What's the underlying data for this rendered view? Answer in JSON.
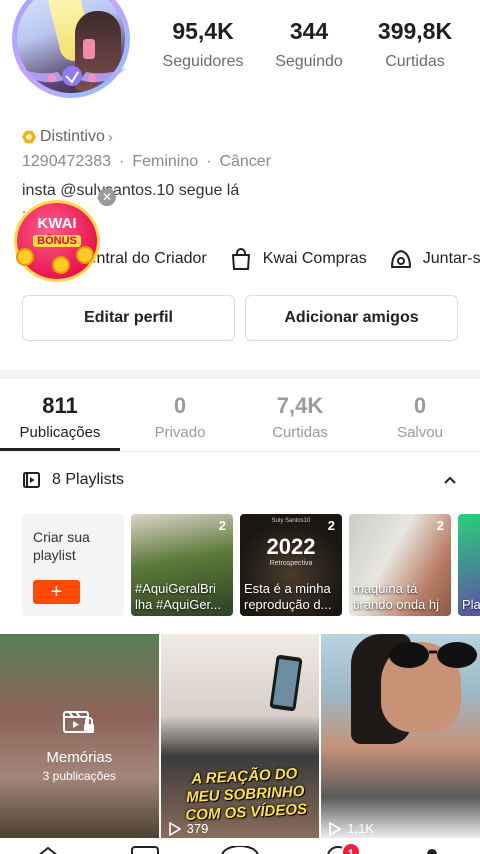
{
  "profile": {
    "stats": [
      {
        "value": "95,4K",
        "label": "Seguidores"
      },
      {
        "value": "344",
        "label": "Seguindo"
      },
      {
        "value": "399,8K",
        "label": "Curtidas"
      }
    ],
    "badge_label": "Distintivo",
    "kwai_id": "1290472383",
    "gender": "Feminino",
    "zodiac": "Câncer",
    "bio": "insta @sulysantos.10 segue lá",
    "bio_more": "..."
  },
  "kwai_bonus": {
    "line1": "KWAI",
    "line2": "BÔNUS"
  },
  "shortcuts": [
    {
      "label": "Central do Criador",
      "icon": "creator-icon"
    },
    {
      "label": "Kwai Compras",
      "icon": "shopping-bag-icon"
    },
    {
      "label": "Juntar-se",
      "icon": "join-icon"
    }
  ],
  "buttons": {
    "edit": "Editar perfil",
    "add_friends": "Adicionar amigos"
  },
  "tabs": [
    {
      "value": "811",
      "label": "Publicações",
      "active": true
    },
    {
      "value": "0",
      "label": "Privado"
    },
    {
      "value": "7,4K",
      "label": "Curtidas"
    },
    {
      "value": "0",
      "label": "Salvou"
    }
  ],
  "playlists": {
    "header": "8 Playlists",
    "create_label": "Criar sua playlist",
    "create_button": "+",
    "items": [
      {
        "count": "2",
        "title_line1": "#AquiGeralBri",
        "title_line2": "lha #AquiGer..."
      },
      {
        "count": "2",
        "title_line1": "Esta é a minha",
        "title_line2": "reprodução d...",
        "big_text": "2022",
        "small_text": "Retrospectiva",
        "top_text": "Suly Santos10"
      },
      {
        "count": "2",
        "title_line1": "maquina tá",
        "title_line2": "tirando onda hj"
      },
      {
        "count": "2",
        "title_line1": "Pla",
        "title_line2": ""
      }
    ]
  },
  "videos": [
    {
      "type": "memories",
      "title": "Memórias",
      "subtitle": "3 publicações"
    },
    {
      "type": "video",
      "views": "379",
      "caption": "A REAÇÃO DO MEU SOBRINHO COM OS VÍDEOS"
    },
    {
      "type": "video",
      "views": "1,1K"
    }
  ],
  "bottom_nav": {
    "notification_count": "1"
  },
  "colors": {
    "accent": "#ff4906",
    "badge": "#f21d3c",
    "bonus": "#e8164f"
  }
}
